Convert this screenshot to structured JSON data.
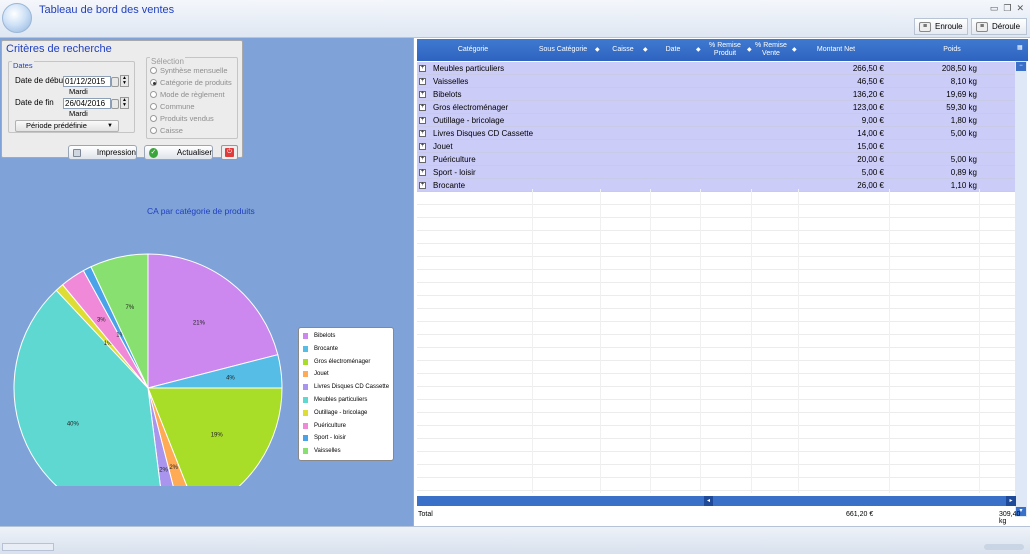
{
  "app": {
    "title": "Tableau de bord des ventes",
    "enroule": "Enroule",
    "deroule": "Déroule"
  },
  "criteria": {
    "title": "Critères de recherche",
    "dates_group": "Dates",
    "start_label": "Date de début",
    "start_value": "01/12/2015",
    "start_day": "Mardi",
    "end_label": "Date de fin",
    "end_value": "26/04/2016",
    "end_day": "Mardi",
    "period_label": "Période prédéfinie",
    "selection_title": "Sélection",
    "options": [
      "Synthèse mensuelle",
      "Catégorie de produits",
      "Mode de règlement",
      "Commune",
      "Produits vendus",
      "Caisse"
    ],
    "selected_index": 1,
    "print_label": "Impression",
    "refresh_label": "Actualiser"
  },
  "chart_data": {
    "type": "pie",
    "title": "CA par catégorie de produits",
    "legend_position": "right",
    "legend": [
      "Bibelots",
      "Brocante",
      "Gros électroménager",
      "Jouet",
      "Livres Disques CD  Cassette",
      "Meubles particuliers",
      "Outillage - bricolage",
      "Puériculture",
      "Sport - loisir",
      "Vaisselles"
    ],
    "slices": [
      {
        "label": "Bibelots",
        "value": 21,
        "text": "21%",
        "color": "#cc88ee"
      },
      {
        "label": "Brocante",
        "value": 4,
        "text": "4%",
        "color": "#55bde6"
      },
      {
        "label": "Gros électroménager",
        "value": 19,
        "text": "19%",
        "color": "#a8dd28"
      },
      {
        "label": "Jouet",
        "value": 2,
        "text": "2%",
        "color": "#ffaa55"
      },
      {
        "label": "Livres Disques CD  Cassette",
        "value": 2,
        "text": "2%",
        "color": "#a994ee"
      },
      {
        "label": "Meubles particuliers",
        "value": 40,
        "text": "40%",
        "color": "#5fd8d2"
      },
      {
        "label": "Outillage - bricolage",
        "value": 1,
        "text": "1%",
        "color": "#dddd33"
      },
      {
        "label": "Puériculture",
        "value": 3,
        "text": "3%",
        "color": "#f08ad8"
      },
      {
        "label": "Sport - loisir",
        "value": 1,
        "text": "1%",
        "color": "#4aa2e8"
      },
      {
        "label": "Vaisselles",
        "value": 7,
        "text": "7%",
        "color": "#88e070"
      }
    ]
  },
  "grid": {
    "columns": [
      "Catégorie",
      "Sous Catégorie",
      "Caisse",
      "Date",
      "% Remise Produit",
      "% Remise Vente",
      "Montant Net",
      "Poids"
    ],
    "rows": [
      {
        "cat": "Meubles particuliers",
        "montant": "266,50 €",
        "poids": "208,50 kg"
      },
      {
        "cat": "Vaisselles",
        "montant": "46,50 €",
        "poids": "8,10 kg"
      },
      {
        "cat": "Bibelots",
        "montant": "136,20 €",
        "poids": "19,69 kg"
      },
      {
        "cat": "Gros électroménager",
        "montant": "123,00 €",
        "poids": "59,30 kg"
      },
      {
        "cat": "Outillage - bricolage",
        "montant": "9,00 €",
        "poids": "1,80 kg"
      },
      {
        "cat": "Livres Disques CD  Cassette",
        "montant": "14,00 €",
        "poids": "5,00 kg"
      },
      {
        "cat": "Jouet",
        "montant": "15,00 €",
        "poids": ""
      },
      {
        "cat": "Puériculture",
        "montant": "20,00 €",
        "poids": "5,00 kg"
      },
      {
        "cat": "Sport - loisir",
        "montant": "5,00 €",
        "poids": "0,89 kg"
      },
      {
        "cat": "Brocante",
        "montant": "26,00 €",
        "poids": "1,10 kg"
      }
    ],
    "total_label": "Total",
    "total_montant": "661,20 €",
    "total_poids": "309,40 kg"
  }
}
